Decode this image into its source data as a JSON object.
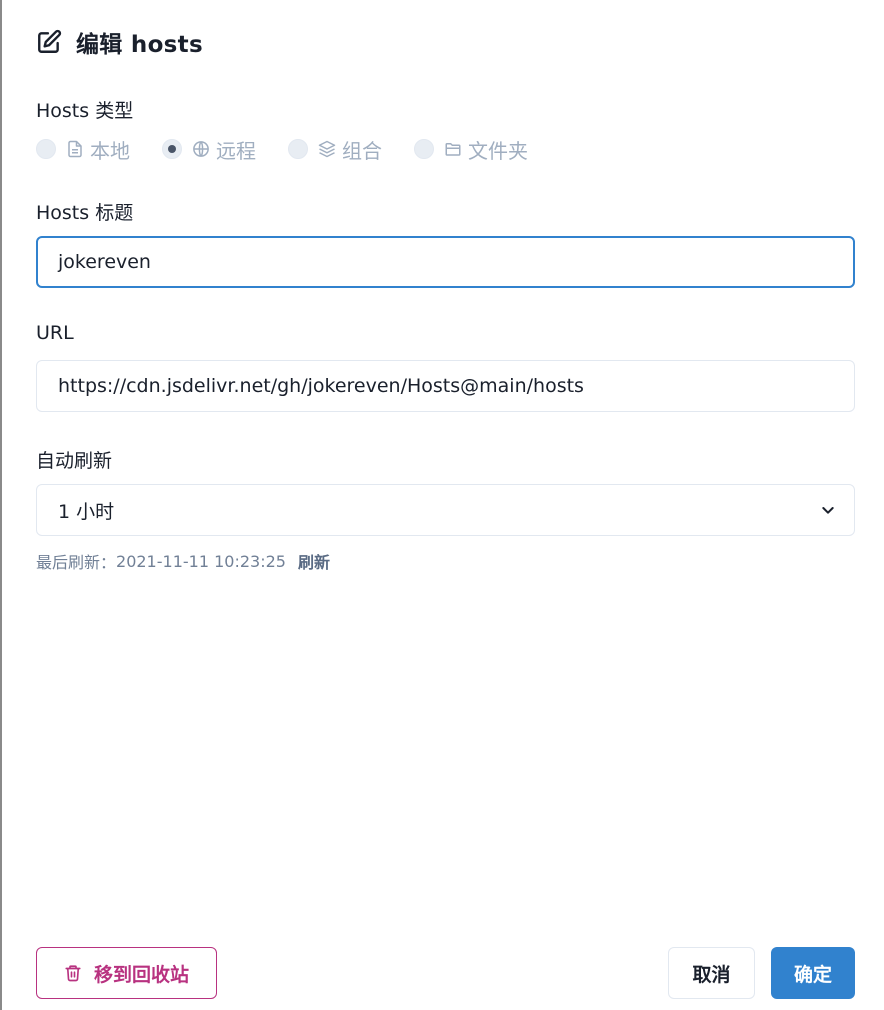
{
  "dialog": {
    "title": "编辑 hosts",
    "header_icon": "edit-icon"
  },
  "hosts_type": {
    "label": "Hosts 类型",
    "options": [
      {
        "label": "本地",
        "icon": "file-icon",
        "checked": false
      },
      {
        "label": "远程",
        "icon": "globe-icon",
        "checked": true
      },
      {
        "label": "组合",
        "icon": "layers-icon",
        "checked": false
      },
      {
        "label": "文件夹",
        "icon": "folder-icon",
        "checked": false
      }
    ]
  },
  "hosts_title": {
    "label": "Hosts 标题",
    "value": "jokereven"
  },
  "url": {
    "label": "URL",
    "value": "https://cdn.jsdelivr.net/gh/jokereven/Hosts@main/hosts"
  },
  "auto_refresh": {
    "label": "自动刷新",
    "selected": "1 小时",
    "last_refresh_label": "最后刷新：",
    "last_refresh_time": "2021-11-11 10:23:25",
    "refresh_link": "刷新"
  },
  "footer": {
    "trash_label": "移到回收站",
    "trash_icon": "trash-icon",
    "cancel_label": "取消",
    "ok_label": "确定"
  },
  "colors": {
    "primary": "#3182ce",
    "danger": "#b83280",
    "muted": "#a0aec0"
  }
}
